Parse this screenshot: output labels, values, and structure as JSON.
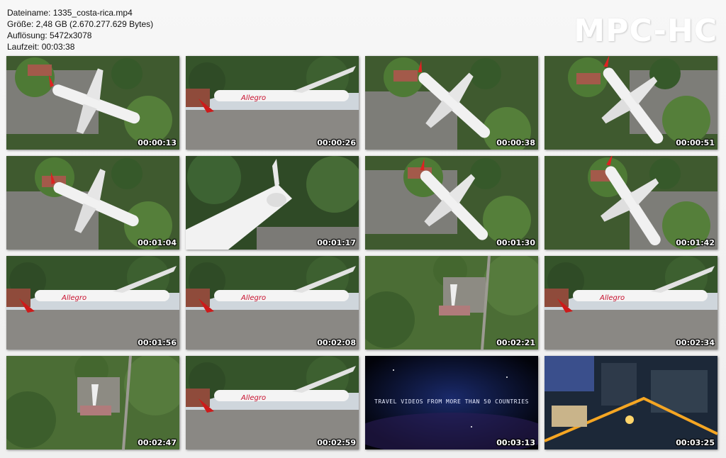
{
  "info": {
    "filename": "Dateiname: 1335_costa-rica.mp4",
    "size": "Größe: 2,48 GB (2.670.277.629 Bytes)",
    "resolution": "Auflösung: 5472x3078",
    "duration": "Laufzeit: 00:03:38"
  },
  "logo": "MPC-HC",
  "thumbnails": [
    {
      "time": "00:00:13",
      "scene": "airplane-aerial"
    },
    {
      "time": "00:00:26",
      "scene": "airplane-side"
    },
    {
      "time": "00:00:38",
      "scene": "airplane-aerial"
    },
    {
      "time": "00:00:51",
      "scene": "airplane-aerial"
    },
    {
      "time": "00:01:04",
      "scene": "airplane-aerial"
    },
    {
      "time": "00:01:17",
      "scene": "airplane-closeup"
    },
    {
      "time": "00:01:30",
      "scene": "airplane-aerial"
    },
    {
      "time": "00:01:42",
      "scene": "airplane-aerial"
    },
    {
      "time": "00:01:56",
      "scene": "airplane-side"
    },
    {
      "time": "00:02:08",
      "scene": "airplane-side"
    },
    {
      "time": "00:02:21",
      "scene": "forest-topdown"
    },
    {
      "time": "00:02:34",
      "scene": "airplane-side"
    },
    {
      "time": "00:02:47",
      "scene": "forest-topdown"
    },
    {
      "time": "00:02:59",
      "scene": "airplane-side"
    },
    {
      "time": "00:03:13",
      "scene": "space-title",
      "caption": "TRAVEL VIDEOS FROM MORE THAN 50 COUNTRIES"
    },
    {
      "time": "00:03:25",
      "scene": "city-night"
    }
  ]
}
